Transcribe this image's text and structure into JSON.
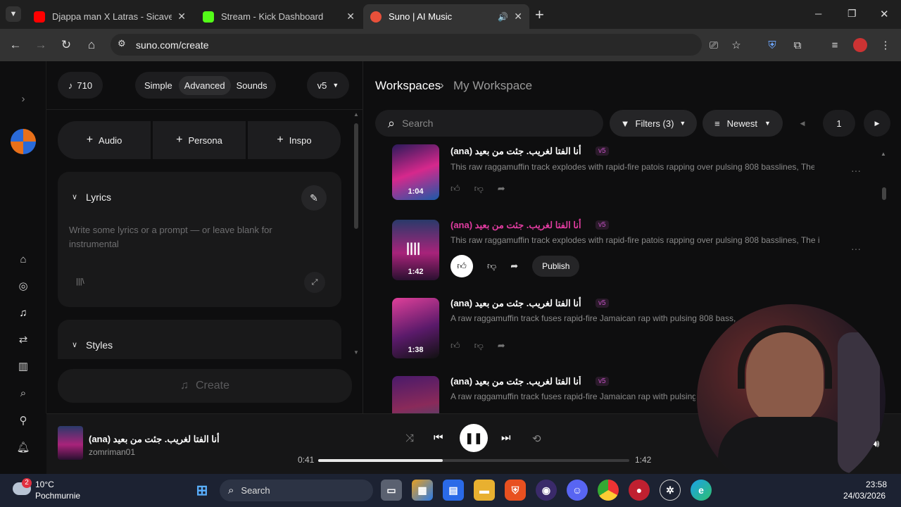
{
  "browser": {
    "tabs": [
      {
        "title": "Djappa man X Latras - Sicavene",
        "favicon_color": "#ff0000"
      },
      {
        "title": "Stream - Kick Dashboard",
        "favicon_color": "#53fc18"
      },
      {
        "title": "Suno | AI Music",
        "favicon_color": "#e8503a"
      }
    ],
    "new_tab": "+",
    "url": "suno.com/create",
    "window_controls": {
      "min": "─",
      "max": "❐",
      "close": "✕"
    }
  },
  "left_panel": {
    "credits": "710",
    "modes": [
      "Simple",
      "Advanced",
      "Sounds"
    ],
    "active_mode": "Advanced",
    "model": "v5",
    "add_buttons": [
      "Audio",
      "Persona",
      "Inspo"
    ],
    "lyrics_label": "Lyrics",
    "lyrics_placeholder": "Write some lyrics or a prompt — or leave blank for instrumental",
    "styles_label": "Styles",
    "create_label": "Create"
  },
  "workspace": {
    "breadcrumb_root": "Workspaces",
    "breadcrumb_current": "My Workspace",
    "search_placeholder": "Search",
    "filters_label": "Filters (3)",
    "sort_label": "Newest",
    "page": "1",
    "songs": [
      {
        "title": "(ana) أنا الفتا لغريب. جئت من بعيد",
        "version": "v5",
        "desc": "This raw raggamuffin track explodes with rapid-fire patois rapping over pulsing 808 basslines, The intr...",
        "duration": "1:04"
      },
      {
        "title": "(ana) أنا الفتا لغريب. جئت من بعيد",
        "version": "v5",
        "desc": "This raw raggamuffin track explodes with rapid-fire patois rapping over pulsing 808 basslines, The intr...",
        "duration": "1:42",
        "publish": "Publish"
      },
      {
        "title": "(ana) أنا الفتا لغريب. جئت من بعيد",
        "version": "v5",
        "desc": "A raw raggamuffin track fuses rapid-fire Jamaican rap with pulsing 808 bass, The",
        "duration": "1:38"
      },
      {
        "title": "(ana) أنا الفتا لغريب. جئت من بعيد",
        "version": "v5",
        "desc": "A raw raggamuffin track fuses rapid-fire Jamaican rap with pulsing 80",
        "duration": ""
      }
    ]
  },
  "player": {
    "title": "(ana) أنا الفتا لغريب. جئت من بعيد",
    "artist": "zomriman01",
    "elapsed": "0:41",
    "total": "1:42",
    "progress": 0.4
  },
  "taskbar": {
    "weather_temp": "10°C",
    "weather_desc": "Pochmurnie",
    "weather_badge": "2",
    "search_label": "Search",
    "time": "23:58",
    "date": "24/03/2026"
  },
  "colors": {
    "accent_pink": "#e03ca0",
    "tag_purple": "#c050c0"
  }
}
